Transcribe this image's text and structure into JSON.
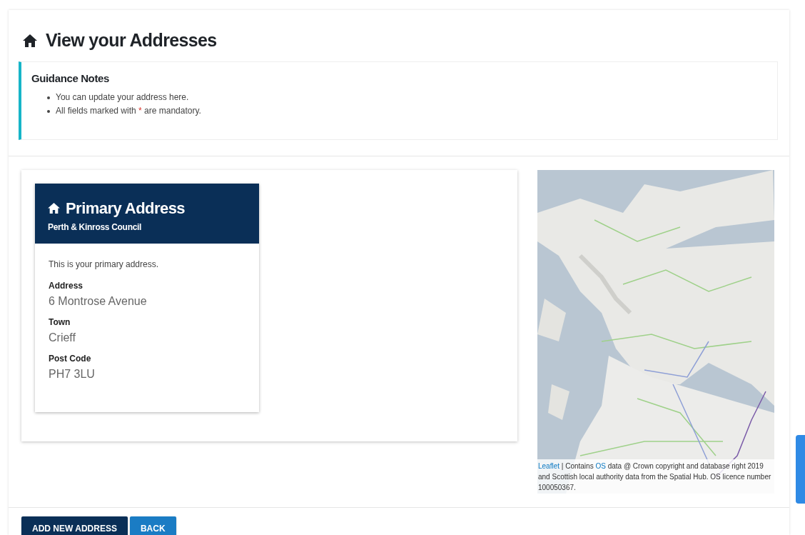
{
  "page_title": "View your Addresses",
  "guidance": {
    "title": "Guidance Notes",
    "items": [
      {
        "parts": [
          "You can update your address here."
        ]
      },
      {
        "parts": [
          "All fields marked with",
          "*",
          "are mandatory."
        ]
      }
    ]
  },
  "address_card": {
    "title": "Primary Address",
    "subtitle": "Perth & Kinross Council",
    "intro": "This is your primary address.",
    "fields": [
      {
        "label": "Address",
        "value": "6 Montrose Avenue"
      },
      {
        "label": "Town",
        "value": "Crieff"
      },
      {
        "label": "Post Code",
        "value": "PH7 3LU"
      }
    ]
  },
  "map": {
    "attribution": [
      {
        "text": "Leaflet",
        "link": true
      },
      {
        "text": " | Contains ",
        "link": false
      },
      {
        "text": "OS",
        "link": true
      },
      {
        "text": " data @ Crown copyright and database right 2019 and Scottish local authority data from the Spatial Hub. OS licence number 100050367.",
        "link": false
      }
    ]
  },
  "buttons": [
    {
      "label": "ADD NEW ADDRESS",
      "kind": "primary"
    },
    {
      "label": "BACK",
      "kind": "secondary"
    }
  ]
}
